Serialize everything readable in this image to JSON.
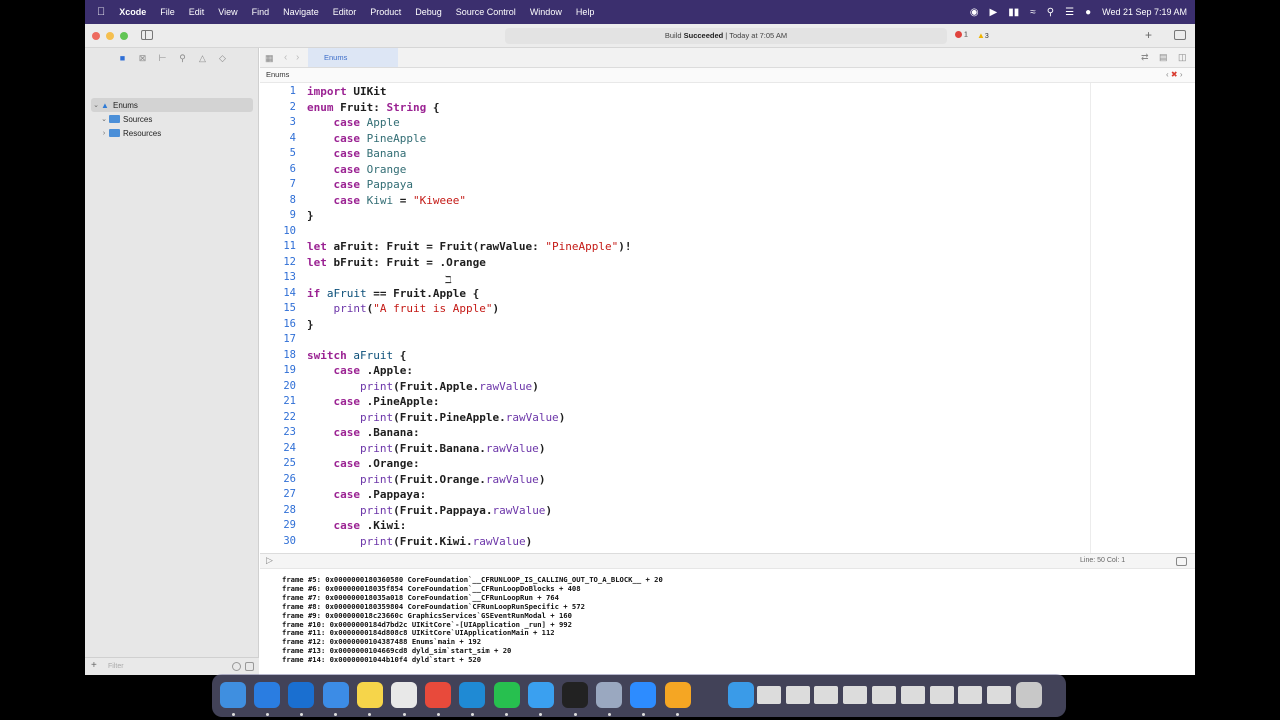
{
  "menubar": {
    "app_name": "Xcode",
    "items": [
      "File",
      "Edit",
      "View",
      "Find",
      "Navigate",
      "Editor",
      "Product",
      "Debug",
      "Source Control",
      "Window",
      "Help"
    ],
    "clock": "Wed 21 Sep  7:19 AM"
  },
  "toolbar": {
    "status_main": "Build ",
    "status_bold": "Succeeded",
    "status_time": " | Today at 7:05 AM",
    "errors": "1",
    "warnings": "3"
  },
  "navigator": {
    "items": [
      {
        "label": "Enums",
        "expanded": true,
        "kind": "project"
      },
      {
        "label": "Sources",
        "expanded": true,
        "kind": "folder"
      },
      {
        "label": "Resources",
        "expanded": false,
        "kind": "folder"
      }
    ],
    "filter_placeholder": "Filter"
  },
  "editor": {
    "tab_label": "Enums",
    "jump_file": "Enums",
    "lines": [
      {
        "n": "1"
      },
      {
        "n": "2"
      },
      {
        "n": "3"
      },
      {
        "n": "4"
      },
      {
        "n": "5"
      },
      {
        "n": "6"
      },
      {
        "n": "7"
      },
      {
        "n": "8"
      },
      {
        "n": "9"
      },
      {
        "n": "10"
      },
      {
        "n": "11"
      },
      {
        "n": "12"
      },
      {
        "n": "13"
      },
      {
        "n": "14"
      },
      {
        "n": "15"
      },
      {
        "n": "16"
      },
      {
        "n": "17"
      },
      {
        "n": "18"
      },
      {
        "n": "19"
      },
      {
        "n": "20"
      },
      {
        "n": "21"
      },
      {
        "n": "22"
      },
      {
        "n": "23"
      },
      {
        "n": "24"
      },
      {
        "n": "25"
      },
      {
        "n": "26"
      },
      {
        "n": "27"
      },
      {
        "n": "28"
      },
      {
        "n": "29"
      },
      {
        "n": "30"
      }
    ],
    "code": {
      "l1_kw": "import",
      "l1_rest": " UIKit",
      "l2_kw": "enum",
      "l2_name": " Fruit",
      "l2_rest": ": ",
      "l2_type": "String",
      "l2_end": " {",
      "l3_kw": "case",
      "l3_val": " Apple",
      "l4_kw": "case",
      "l4_val": " PineApple",
      "l5_kw": "case",
      "l5_val": " Banana",
      "l6_kw": "case",
      "l6_val": " Orange",
      "l7_kw": "case",
      "l7_val": " Pappaya",
      "l8_kw": "case",
      "l8_val": " Kiwi",
      "l8_eq": " = ",
      "l8_str": "\"Kiweee\"",
      "l9": "}",
      "l11_kw": "let",
      "l11_name": " aFruit",
      "l11_mid": ": Fruit = Fruit(rawValue: ",
      "l11_str": "\"PineApple\"",
      "l11_end": ")!",
      "l12_kw": "let",
      "l12_name": " bFruit",
      "l12_mid": ": Fruit = .Orange",
      "l14_kw": "if",
      "l14_name": " aFruit",
      "l14_rest": " == Fruit.Apple {",
      "l15_fn": "print",
      "l15_open": "(",
      "l15_str": "\"A fruit is Apple\"",
      "l15_close": ")",
      "l16": "}",
      "l18_kw": "switch",
      "l18_name": " aFruit",
      "l18_rest": " {",
      "l19_kw": "case",
      "l19_rest": " .Apple:",
      "l20_fn": "print",
      "l20_mid": "(Fruit.Apple.",
      "l20_prop": "rawValue",
      "l20_end": ")",
      "l21_kw": "case",
      "l21_rest": " .PineApple:",
      "l22_fn": "print",
      "l22_mid": "(Fruit.PineApple.",
      "l22_prop": "rawValue",
      "l22_end": ")",
      "l23_kw": "case",
      "l23_rest": " .Banana:",
      "l24_fn": "print",
      "l24_mid": "(Fruit.Banana.",
      "l24_prop": "rawValue",
      "l24_end": ")",
      "l25_kw": "case",
      "l25_rest": " .Orange:",
      "l26_fn": "print",
      "l26_mid": "(Fruit.Orange.",
      "l26_prop": "rawValue",
      "l26_end": ")",
      "l27_kw": "case",
      "l27_rest": " .Pappaya:",
      "l28_fn": "print",
      "l28_mid": "(Fruit.Pappaya.",
      "l28_prop": "rawValue",
      "l28_end": ")",
      "l29_kw": "case",
      "l29_rest": " .Kiwi:",
      "l30_fn": "print",
      "l30_mid": "(Fruit.Kiwi.",
      "l30_prop": "rawValue",
      "l30_end": ")"
    }
  },
  "debug": {
    "position": "Line: 50  Col: 1"
  },
  "console": {
    "lines": [
      "frame #5: 0x0000000180360580 CoreFoundation`__CFRUNLOOP_IS_CALLING_OUT_TO_A_BLOCK__ + 20",
      "frame #6: 0x000000018035f854 CoreFoundation`__CFRunLoopDoBlocks + 408",
      "frame #7: 0x000000018035a018 CoreFoundation`__CFRunLoopRun + 764",
      "frame #8: 0x0000000180359804 CoreFoundation`CFRunLoopRunSpecific + 572",
      "frame #9: 0x000000018c23660c GraphicsServices`GSEventRunModal + 160",
      "frame #10: 0x0000000184d7bd2c UIKitCore`-[UIApplication _run] + 992",
      "frame #11: 0x0000000184d808c8 UIKitCore`UIApplicationMain + 112",
      "frame #12: 0x0000000104387488 Enums`main + 192",
      "frame #13: 0x0000000104669cd8 dyld_sim`start_sim + 20",
      "frame #14: 0x00000001044b10f4 dyld`start + 520"
    ]
  },
  "colors": {
    "menubar_bg": "#3b2f6e",
    "keyword": "#9b2393",
    "string": "#c41a16",
    "line_number": "#2f6fd6",
    "error": "#e0443e",
    "warning": "#f0b400"
  },
  "dock": {
    "icons": [
      "finder-icon",
      "safari-icon",
      "xcode-icon",
      "xcode-beta-icon",
      "notes-icon",
      "slack-icon",
      "chrome-icon",
      "vscode-icon",
      "whatsapp-icon",
      "simulator-icon",
      "terminal-icon",
      "preview-icon",
      "zoom-icon",
      "pages-icon",
      "folder-icon",
      "window-thumb-icon",
      "window-thumb-icon",
      "window-thumb-icon",
      "window-thumb-icon",
      "window-thumb-icon",
      "window-thumb-icon",
      "window-thumb-icon",
      "window-thumb-icon",
      "window-thumb-icon",
      "trash-icon"
    ]
  }
}
